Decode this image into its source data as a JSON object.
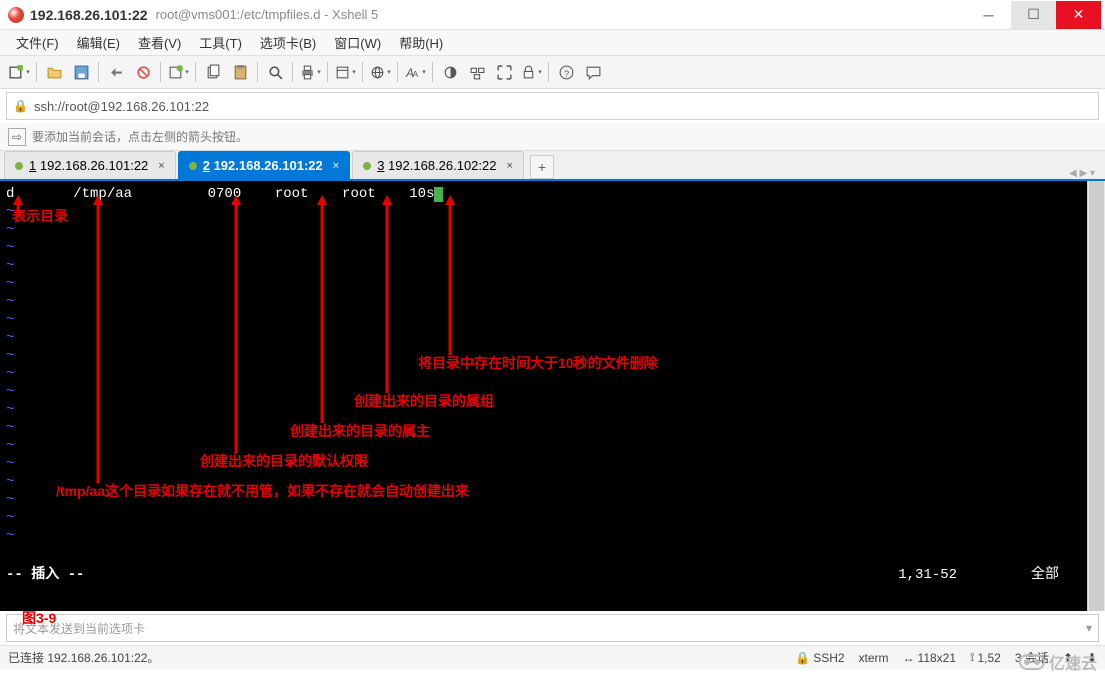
{
  "titlebar": {
    "title": "192.168.26.101:22",
    "subtitle": "root@vms001:/etc/tmpfiles.d - Xshell 5"
  },
  "menu": {
    "file": "文件(F)",
    "edit": "编辑(E)",
    "view": "查看(V)",
    "tools": "工具(T)",
    "tabs": "选项卡(B)",
    "window": "窗口(W)",
    "help": "帮助(H)"
  },
  "address": {
    "url": "ssh://root@192.168.26.101:22"
  },
  "hint": {
    "text": "要添加当前会话，点击左侧的箭头按钮。"
  },
  "tabs": {
    "t1": "1 192.168.26.101:22",
    "t2": "2 192.168.26.101:22",
    "t3": "3 192.168.26.102:22"
  },
  "terminal": {
    "line": "d       /tmp/aa         0700    root    root    10s",
    "mode": "-- 插入 --",
    "position": "1,31-52",
    "scope": "全部"
  },
  "annotations": {
    "a1": "表示目录",
    "a2": "/tmp/aa这个目录如果存在就不用管，如果不存在就会自动创建出来",
    "a3": "创建出来的目录的默认权限",
    "a4": "创建出来的目录的属主",
    "a5": "创建出来的目录的属组",
    "a6": "将目录中存在时间大于10秒的文件删除",
    "fig": "图3-9"
  },
  "bottom_input": {
    "placeholder": "将文本发送到当前选项卡"
  },
  "status": {
    "connection": "已连接 192.168.26.101:22。",
    "ssh": "SSH2",
    "term": "xterm",
    "size": "118x21",
    "cursor": "1,52",
    "sessions": "3 会话"
  },
  "watermark": "亿速云"
}
